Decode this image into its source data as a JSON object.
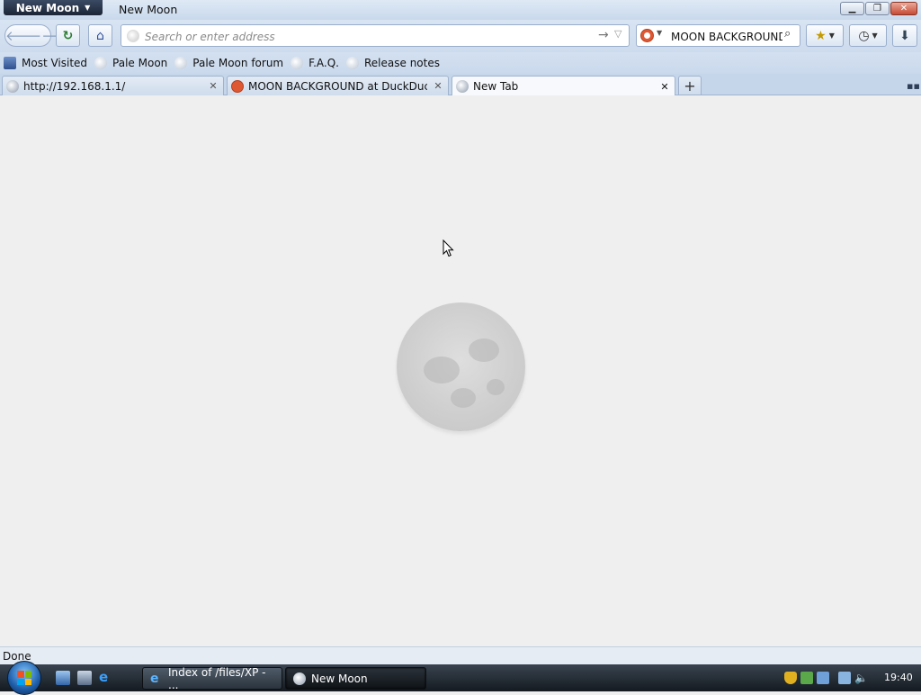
{
  "window": {
    "app_menu_label": "New Moon",
    "title": "New Moon"
  },
  "navbar": {
    "url_placeholder": "Search or enter address",
    "search_value": "MOON BACKGROUND"
  },
  "bookmarks": [
    {
      "label": "Most Visited"
    },
    {
      "label": "Pale Moon"
    },
    {
      "label": "Pale Moon forum"
    },
    {
      "label": "F.A.Q."
    },
    {
      "label": "Release notes"
    }
  ],
  "tabs": [
    {
      "label": "http://192.168.1.1/"
    },
    {
      "label": "MOON BACKGROUND at DuckDuckGo"
    },
    {
      "label": "New Tab",
      "active": true
    }
  ],
  "status": {
    "text": "Done"
  },
  "taskbar": {
    "tasks": [
      {
        "label": "Index of /files/XP - ..."
      },
      {
        "label": "New Moon"
      }
    ],
    "clock": "19:40"
  },
  "colors": {
    "accent": "#2f4f9a",
    "duckduckgo": "#de5833",
    "content_bg": "#efefef"
  },
  "icons": {
    "moon_logo": "moon-logo-icon"
  }
}
